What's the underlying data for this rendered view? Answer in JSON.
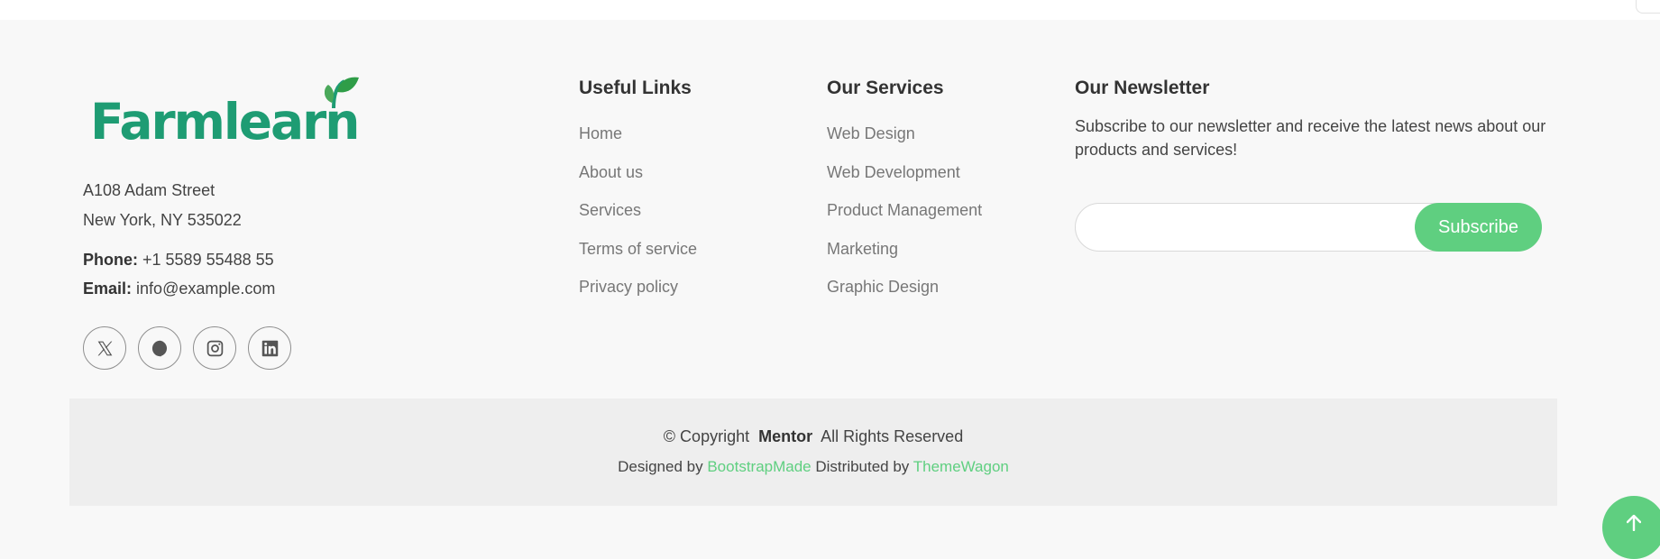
{
  "brand": {
    "logo_text": "Farmlearn",
    "address_line1": "A108 Adam Street",
    "address_line2": "New York, NY 535022",
    "phone_label": "Phone:",
    "phone_value": "+1 5589 55488 55",
    "email_label": "Email:",
    "email_value": "info@example.com",
    "social_icons": [
      "x-icon",
      "facebook-icon",
      "instagram-icon",
      "linkedin-icon"
    ]
  },
  "useful_links": {
    "title": "Useful Links",
    "items": [
      "Home",
      "About us",
      "Services",
      "Terms of service",
      "Privacy policy"
    ]
  },
  "services": {
    "title": "Our Services",
    "items": [
      "Web Design",
      "Web Development",
      "Product Management",
      "Marketing",
      "Graphic Design"
    ]
  },
  "newsletter": {
    "title": "Our Newsletter",
    "description": "Subscribe to our newsletter and receive the latest news about our products and services!",
    "input_value": "",
    "button_label": "Subscribe"
  },
  "copyright": {
    "prefix": "© Copyright",
    "site_name": "Mentor",
    "suffix": "All Rights Reserved",
    "designed_by_label": "Designed by",
    "designer": "BootstrapMade",
    "distributed_by_label": "Distributed by",
    "distributor": "ThemeWagon"
  },
  "colors": {
    "brand_green": "#1e9c73",
    "accent_green": "#5fcf80",
    "footer_bg": "#f8f8f8",
    "copyright_bg": "#eeeeee"
  }
}
